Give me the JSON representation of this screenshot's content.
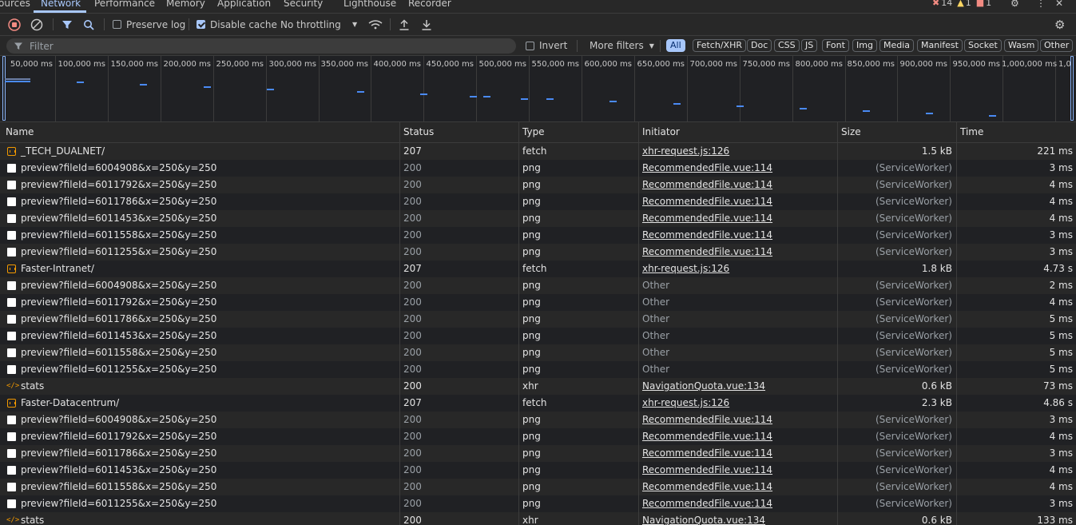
{
  "tabs": [
    {
      "label": "ources"
    },
    {
      "label": "Network"
    },
    {
      "label": "Performance"
    },
    {
      "label": "Memory"
    },
    {
      "label": "Application"
    },
    {
      "label": "Security"
    },
    {
      "label": "Lighthouse"
    },
    {
      "label": "Recorder"
    }
  ],
  "status_counts": {
    "errors": "14",
    "warnings": "1",
    "issues": "1"
  },
  "toolbar": {
    "preserve_log": "Preserve log",
    "disable_cache": "Disable cache",
    "throttling": "No throttling"
  },
  "filter": {
    "placeholder": "Filter",
    "invert": "Invert",
    "more_filters": "More filters",
    "chips": [
      "All",
      "Fetch/XHR",
      "Doc",
      "CSS",
      "JS",
      "Font",
      "Img",
      "Media",
      "Manifest",
      "Socket",
      "Wasm",
      "Other"
    ]
  },
  "timeline": {
    "ticks": [
      "50,000 ms",
      "100,000 ms",
      "150,000 ms",
      "200,000 ms",
      "250,000 ms",
      "300,000 ms",
      "350,000 ms",
      "400,000 ms",
      "450,000 ms",
      "500,000 ms",
      "550,000 ms",
      "600,000 ms",
      "650,000 ms",
      "700,000 ms",
      "750,000 ms",
      "800,000 ms",
      "850,000 ms",
      "900,000 ms",
      "950,000 ms",
      "1,000,000 ms",
      "1,0"
    ]
  },
  "columns": {
    "name": "Name",
    "status": "Status",
    "type": "Type",
    "initiator": "Initiator",
    "size": "Size",
    "time": "Time"
  },
  "rows": [
    {
      "icon": "fetch",
      "name": "_TECH_DUALNET/",
      "status": "207",
      "type": "fetch",
      "initiator": "xhr-request.js:126",
      "init_link": true,
      "size": "1.5 kB",
      "time": "221 ms",
      "dim": false
    },
    {
      "icon": "doc",
      "name": "preview?fileId=6004908&x=250&y=250",
      "status": "200",
      "type": "png",
      "initiator": "RecommendedFile.vue:114",
      "init_link": true,
      "size": "(ServiceWorker)",
      "time": "3 ms",
      "dim": true
    },
    {
      "icon": "doc",
      "name": "preview?fileId=6011792&x=250&y=250",
      "status": "200",
      "type": "png",
      "initiator": "RecommendedFile.vue:114",
      "init_link": true,
      "size": "(ServiceWorker)",
      "time": "4 ms",
      "dim": true
    },
    {
      "icon": "doc",
      "name": "preview?fileId=6011786&x=250&y=250",
      "status": "200",
      "type": "png",
      "initiator": "RecommendedFile.vue:114",
      "init_link": true,
      "size": "(ServiceWorker)",
      "time": "4 ms",
      "dim": true
    },
    {
      "icon": "doc",
      "name": "preview?fileId=6011453&x=250&y=250",
      "status": "200",
      "type": "png",
      "initiator": "RecommendedFile.vue:114",
      "init_link": true,
      "size": "(ServiceWorker)",
      "time": "4 ms",
      "dim": true
    },
    {
      "icon": "doc",
      "name": "preview?fileId=6011558&x=250&y=250",
      "status": "200",
      "type": "png",
      "initiator": "RecommendedFile.vue:114",
      "init_link": true,
      "size": "(ServiceWorker)",
      "time": "3 ms",
      "dim": true
    },
    {
      "icon": "doc",
      "name": "preview?fileId=6011255&x=250&y=250",
      "status": "200",
      "type": "png",
      "initiator": "RecommendedFile.vue:114",
      "init_link": true,
      "size": "(ServiceWorker)",
      "time": "3 ms",
      "dim": true
    },
    {
      "icon": "fetch",
      "name": "Faster-Intranet/",
      "status": "207",
      "type": "fetch",
      "initiator": "xhr-request.js:126",
      "init_link": true,
      "size": "1.8 kB",
      "time": "4.73 s",
      "dim": false
    },
    {
      "icon": "doc",
      "name": "preview?fileId=6004908&x=250&y=250",
      "status": "200",
      "type": "png",
      "initiator": "Other",
      "init_link": false,
      "size": "(ServiceWorker)",
      "time": "2 ms",
      "dim": true
    },
    {
      "icon": "doc",
      "name": "preview?fileId=6011792&x=250&y=250",
      "status": "200",
      "type": "png",
      "initiator": "Other",
      "init_link": false,
      "size": "(ServiceWorker)",
      "time": "4 ms",
      "dim": true
    },
    {
      "icon": "doc",
      "name": "preview?fileId=6011786&x=250&y=250",
      "status": "200",
      "type": "png",
      "initiator": "Other",
      "init_link": false,
      "size": "(ServiceWorker)",
      "time": "5 ms",
      "dim": true
    },
    {
      "icon": "doc",
      "name": "preview?fileId=6011453&x=250&y=250",
      "status": "200",
      "type": "png",
      "initiator": "Other",
      "init_link": false,
      "size": "(ServiceWorker)",
      "time": "5 ms",
      "dim": true
    },
    {
      "icon": "doc",
      "name": "preview?fileId=6011558&x=250&y=250",
      "status": "200",
      "type": "png",
      "initiator": "Other",
      "init_link": false,
      "size": "(ServiceWorker)",
      "time": "5 ms",
      "dim": true
    },
    {
      "icon": "doc",
      "name": "preview?fileId=6011255&x=250&y=250",
      "status": "200",
      "type": "png",
      "initiator": "Other",
      "init_link": false,
      "size": "(ServiceWorker)",
      "time": "5 ms",
      "dim": true
    },
    {
      "icon": "xhr",
      "name": "stats",
      "status": "200",
      "type": "xhr",
      "initiator": "NavigationQuota.vue:134",
      "init_link": true,
      "size": "0.6 kB",
      "time": "73 ms",
      "dim": false
    },
    {
      "icon": "fetch",
      "name": "Faster-Datacentrum/",
      "status": "207",
      "type": "fetch",
      "initiator": "xhr-request.js:126",
      "init_link": true,
      "size": "2.3 kB",
      "time": "4.86 s",
      "dim": false
    },
    {
      "icon": "doc",
      "name": "preview?fileId=6004908&x=250&y=250",
      "status": "200",
      "type": "png",
      "initiator": "RecommendedFile.vue:114",
      "init_link": true,
      "size": "(ServiceWorker)",
      "time": "3 ms",
      "dim": true
    },
    {
      "icon": "doc",
      "name": "preview?fileId=6011792&x=250&y=250",
      "status": "200",
      "type": "png",
      "initiator": "RecommendedFile.vue:114",
      "init_link": true,
      "size": "(ServiceWorker)",
      "time": "4 ms",
      "dim": true
    },
    {
      "icon": "doc",
      "name": "preview?fileId=6011786&x=250&y=250",
      "status": "200",
      "type": "png",
      "initiator": "RecommendedFile.vue:114",
      "init_link": true,
      "size": "(ServiceWorker)",
      "time": "3 ms",
      "dim": true
    },
    {
      "icon": "doc",
      "name": "preview?fileId=6011453&x=250&y=250",
      "status": "200",
      "type": "png",
      "initiator": "RecommendedFile.vue:114",
      "init_link": true,
      "size": "(ServiceWorker)",
      "time": "4 ms",
      "dim": true
    },
    {
      "icon": "doc",
      "name": "preview?fileId=6011558&x=250&y=250",
      "status": "200",
      "type": "png",
      "initiator": "RecommendedFile.vue:114",
      "init_link": true,
      "size": "(ServiceWorker)",
      "time": "4 ms",
      "dim": true
    },
    {
      "icon": "doc",
      "name": "preview?fileId=6011255&x=250&y=250",
      "status": "200",
      "type": "png",
      "initiator": "RecommendedFile.vue:114",
      "init_link": true,
      "size": "(ServiceWorker)",
      "time": "3 ms",
      "dim": true
    },
    {
      "icon": "xhr",
      "name": "stats",
      "status": "200",
      "type": "xhr",
      "initiator": "NavigationQuota.vue:134",
      "init_link": true,
      "size": "0.6 kB",
      "time": "133 ms",
      "dim": false
    }
  ]
}
